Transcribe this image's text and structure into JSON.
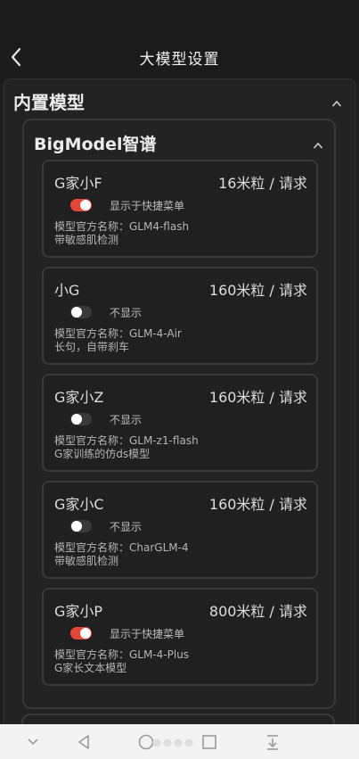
{
  "header": {
    "title": "大模型设置"
  },
  "section": {
    "title": "内置模型"
  },
  "group": {
    "title": "BigModel智谱"
  },
  "cards": [
    {
      "name": "G家小F",
      "price": "16米粒 / 请求",
      "enabled": true,
      "toggle_label": "显示于快捷菜单",
      "official": "模型官方名称：GLM4-flash",
      "desc": "带敏感肌检测"
    },
    {
      "name": "小G",
      "price": "160米粒 / 请求",
      "enabled": false,
      "toggle_label": "不显示",
      "official": "模型官方名称：GLM-4-Air",
      "desc": "长句，自带刹车"
    },
    {
      "name": "G家小Z",
      "price": "160米粒 / 请求",
      "enabled": false,
      "toggle_label": "不显示",
      "official": "模型官方名称：GLM-z1-flash",
      "desc": "G家训练的仿ds模型"
    },
    {
      "name": "G家小C",
      "price": "160米粒 / 请求",
      "enabled": false,
      "toggle_label": "不显示",
      "official": "模型官方名称：CharGLM-4",
      "desc": "带敏感肌检测"
    },
    {
      "name": "G家小P",
      "price": "800米粒 / 请求",
      "enabled": true,
      "toggle_label": "显示于快捷菜单",
      "official": "模型官方名称：GLM-4-Plus",
      "desc": "G家长文本模型"
    }
  ],
  "colors": {
    "toggle_on": "#e44638",
    "toggle_off": "#3a3a3a",
    "background": "#1e1e1e"
  }
}
